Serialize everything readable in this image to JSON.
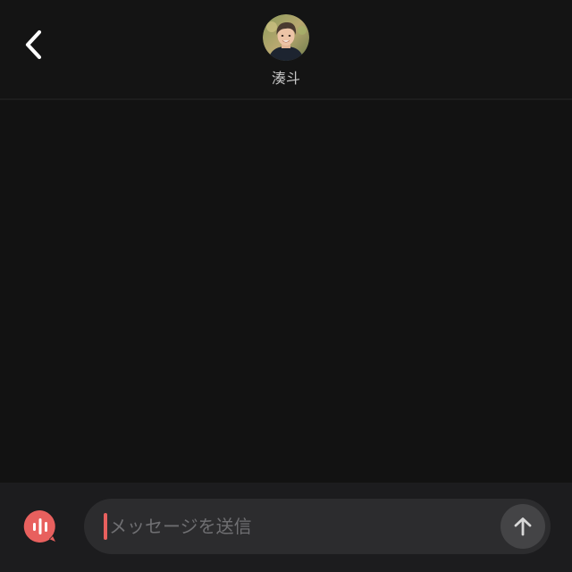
{
  "header": {
    "back_icon": "chevron-left-icon",
    "avatar_icon": "profile-photo",
    "contact_name": "湊斗"
  },
  "composer": {
    "voice_icon": "voice-message-icon",
    "input_placeholder": "メッセージを送信",
    "input_value": "",
    "send_icon": "arrow-up-icon"
  },
  "colors": {
    "background": "#121212",
    "composer_background": "#1c1c1e",
    "input_background": "#2c2c2e",
    "accent": "#e8605e",
    "send_button": "#444446",
    "text_secondary": "#c8c8c8"
  }
}
